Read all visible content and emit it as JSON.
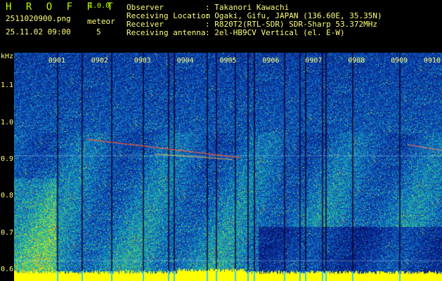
{
  "app": {
    "name": "H R O F F T",
    "version": "1.0.0"
  },
  "file": {
    "name": "2511020900.png",
    "datetime": "25.11.02 09:00"
  },
  "meteor": {
    "label": "meteor",
    "count": "5"
  },
  "info": [
    {
      "key": "Observer",
      "value": ": Takanori Kawachi"
    },
    {
      "key": "Receiving Location",
      "value": ": Ogaki, Gifu, JAPAN (136.60E, 35.35N)"
    },
    {
      "key": "Receiver",
      "value": ": R820T2(RTL-SDR) SDR-Sharp 53.372MHz"
    },
    {
      "key": "Receiving antenna",
      "value": ": 2el-HB9CV Vertical (el. E-W)"
    }
  ],
  "spectrogram": {
    "y_unit": "kHz",
    "y_ticks": [
      "1.1",
      "1.0",
      "0.9",
      "0.8",
      "0.7",
      "0.6"
    ],
    "y_range": [
      0.57,
      1.19
    ],
    "x_ticks": [
      "0901",
      "0902",
      "0903",
      "0904",
      "0905",
      "0906",
      "0907",
      "0908",
      "0909",
      "0910"
    ],
    "x_range_minutes": [
      0,
      10
    ],
    "vertical_line_minutes": [
      1.0,
      1.58,
      2.26,
      3.0,
      3.6,
      3.72,
      4.5,
      4.72,
      5.15,
      5.45,
      5.6,
      6.3,
      6.67,
      6.8,
      7.2,
      7.28,
      7.9,
      9.0
    ]
  },
  "colors": {
    "header_text": "#ffff7a",
    "logo": "#b9ff00",
    "background_noise": "#0b3fa3",
    "signal_low": "#1aa3c6",
    "signal_high": "#f2e61a",
    "baseline": "#ffff00"
  }
}
